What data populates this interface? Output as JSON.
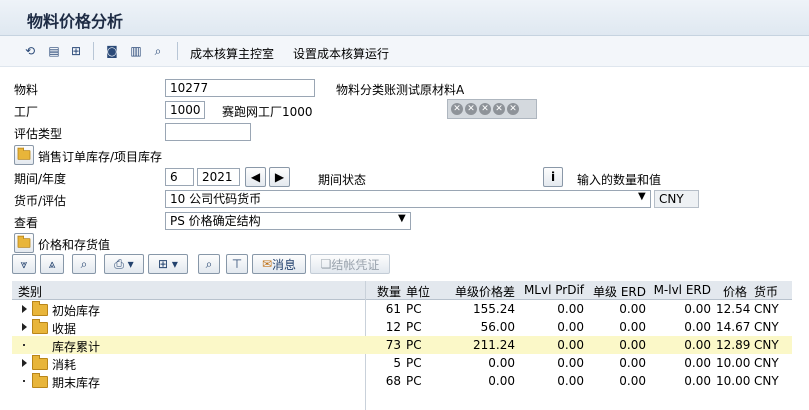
{
  "title": "物料价格分析",
  "toolbar": {
    "btn1": "成本核算主控室",
    "btn2": "设置成本核算运行"
  },
  "form": {
    "material_label": "物料",
    "material_value": "10277",
    "material_desc": "物料分类账测试原材料A",
    "plant_label": "工厂",
    "plant_value": "1000",
    "plant_desc": "赛跑网工厂1000",
    "valtype_label": "评估类型",
    "valtype_value": "",
    "sales_btn": "销售订单库存/项目库存",
    "period_label": "期间/年度",
    "period_value": "6",
    "year_value": "2021",
    "period_status_label": "期间状态",
    "qty_value_label": "输入的数量和值",
    "currency_label": "货币/评估",
    "currency_value": "10 公司代码货币",
    "currency_code": "CNY",
    "view_label": "查看",
    "view_value": "PS 价格确定结构",
    "price_btn": "价格和存货值"
  },
  "gridtoolbar": {
    "msg": "消息",
    "post": "结帐凭证"
  },
  "grid": {
    "headers": [
      "类别",
      "数量",
      "单位",
      "单级价格差",
      "MLvl PrDif",
      "单级 ERD",
      "M-lvl ERD",
      "价格",
      "货币"
    ],
    "rows": [
      {
        "name": "初始库存",
        "qty": "61",
        "unit": "PC",
        "sdiff": "155.24",
        "mlvl": "0.00",
        "serd": "0.00",
        "merd": "0.00",
        "price": "12.54",
        "cur": "CNY"
      },
      {
        "name": "收据",
        "qty": "12",
        "unit": "PC",
        "sdiff": "56.00",
        "mlvl": "0.00",
        "serd": "0.00",
        "merd": "0.00",
        "price": "14.67",
        "cur": "CNY"
      },
      {
        "name": "库存累计",
        "qty": "73",
        "unit": "PC",
        "sdiff": "211.24",
        "mlvl": "0.00",
        "serd": "0.00",
        "merd": "0.00",
        "price": "12.89",
        "cur": "CNY"
      },
      {
        "name": "消耗",
        "qty": "5",
        "unit": "PC",
        "sdiff": "0.00",
        "mlvl": "0.00",
        "serd": "0.00",
        "merd": "0.00",
        "price": "10.00",
        "cur": "CNY"
      },
      {
        "name": "期末库存",
        "qty": "68",
        "unit": "PC",
        "sdiff": "0.00",
        "mlvl": "0.00",
        "serd": "0.00",
        "merd": "0.00",
        "price": "10.00",
        "cur": "CNY"
      }
    ]
  }
}
